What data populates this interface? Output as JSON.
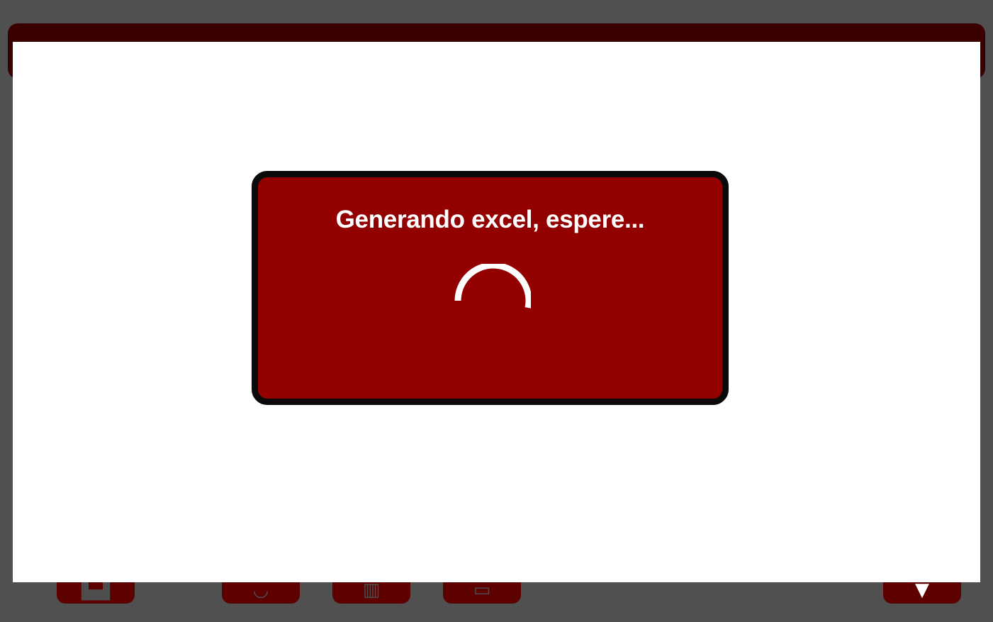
{
  "dialog": {
    "message": "Generando excel, espere...",
    "spinner_icon": "loading-spinner-icon"
  },
  "background_toolbar": {
    "buttons": [
      {
        "name": "home-button",
        "icon": "home-icon"
      },
      {
        "name": "search-button",
        "icon": "search-icon"
      },
      {
        "name": "columns-button",
        "icon": "columns-icon"
      },
      {
        "name": "copy-button",
        "icon": "copy-icon"
      },
      {
        "name": "dropdown-button",
        "icon": "chevron-down-icon"
      }
    ]
  },
  "colors": {
    "backdrop": "#505050",
    "header_dark": "#3a0000",
    "dialog_fill": "#930000",
    "dialog_border": "#0a0a0a",
    "text": "#ffffff"
  }
}
